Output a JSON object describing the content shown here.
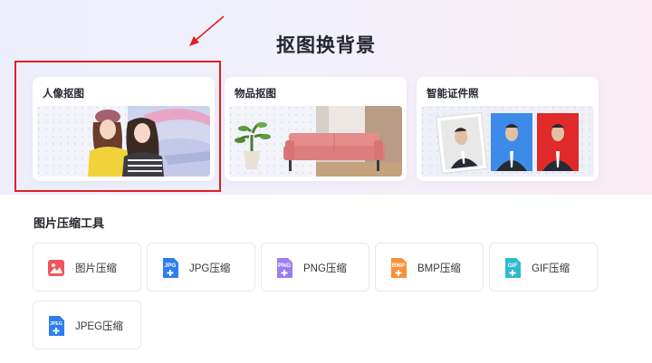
{
  "hero": {
    "title": "抠图换背景",
    "cards": [
      {
        "title": "人像抠图"
      },
      {
        "title": "物品抠图"
      },
      {
        "title": "智能证件照"
      }
    ]
  },
  "compress": {
    "title": "图片压缩工具",
    "tools": [
      {
        "label": "图片压缩",
        "icon": "image-compress-icon",
        "color": "#f0565a"
      },
      {
        "label": "JPG压缩",
        "icon": "jpg-file-icon",
        "badge": "JPG",
        "color": "#2e7ef2"
      },
      {
        "label": "PNG压缩",
        "icon": "png-file-icon",
        "badge": "PNG",
        "color": "#9b7ef0"
      },
      {
        "label": "BMP压缩",
        "icon": "bmp-file-icon",
        "badge": "BMP",
        "color": "#f5923a"
      },
      {
        "label": "GIF压缩",
        "icon": "gif-file-icon",
        "badge": "GIF",
        "color": "#2fb9cf"
      },
      {
        "label": "JPEG压缩",
        "icon": "jpeg-file-icon",
        "badge": "JPEG",
        "color": "#2e7ef2"
      }
    ]
  },
  "annotation_color": "#e02020"
}
